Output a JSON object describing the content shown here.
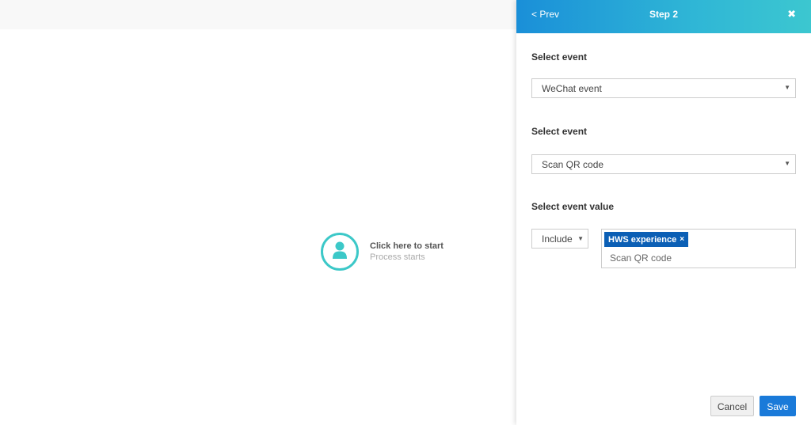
{
  "canvas": {
    "start_node": {
      "title": "Click here to start",
      "subtitle": "Process starts",
      "icon": "user-icon",
      "accent_color": "#3cc8c8"
    }
  },
  "panel": {
    "header": {
      "prev_label": "< Prev",
      "title": "Step 2",
      "close_label": "✖",
      "gradient": [
        "#1a8fd8",
        "#3cc7d0"
      ]
    },
    "section1": {
      "label": "Select event",
      "value": "WeChat event"
    },
    "section2": {
      "label": "Select event",
      "value": "Scan QR code"
    },
    "section3": {
      "label": "Select event value",
      "operator": "Include",
      "tags": [
        {
          "label": "HWS experience",
          "remove": "×"
        }
      ],
      "input_text": "Scan QR code",
      "tag_color": "#0b5fb5"
    },
    "footer": {
      "cancel_label": "Cancel",
      "save_label": "Save",
      "primary_color": "#1a7ad9"
    }
  }
}
